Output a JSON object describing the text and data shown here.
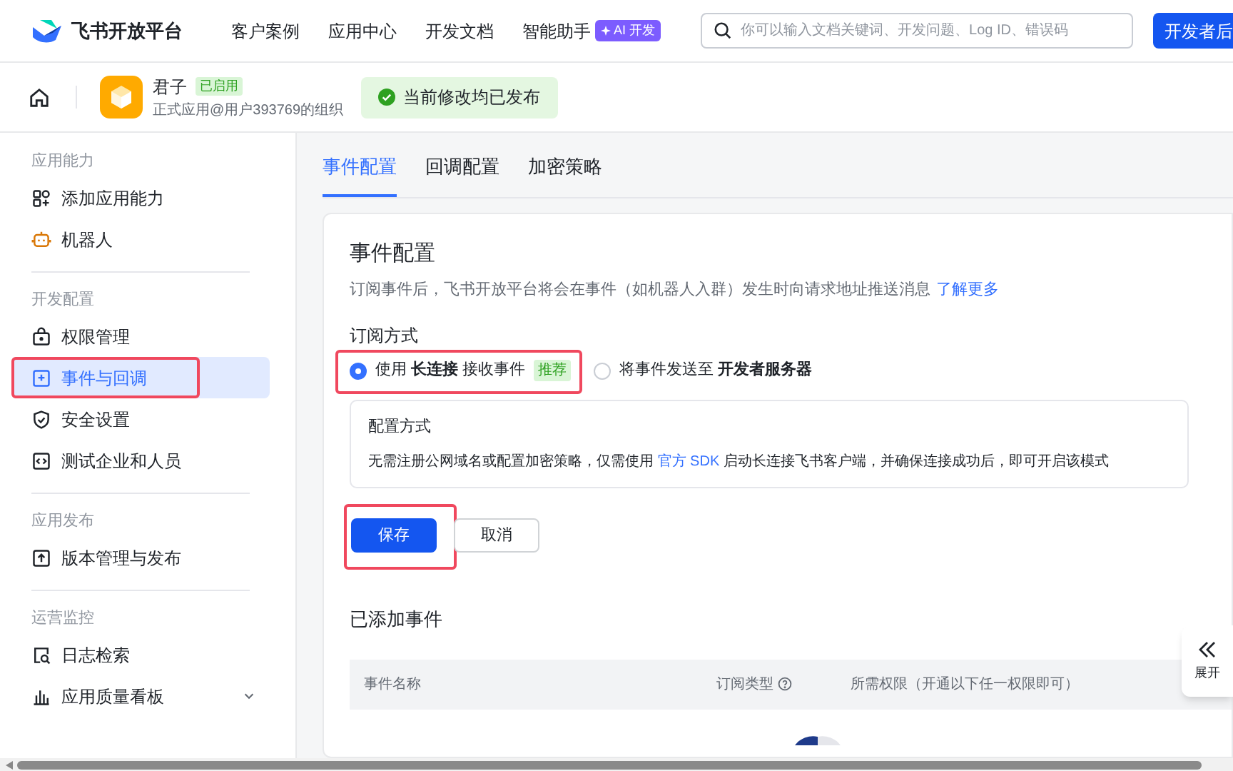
{
  "topnav": {
    "brand": "飞书开放平台",
    "links": [
      "客户案例",
      "应用中心",
      "开发文档",
      "智能助手"
    ],
    "ai_badge": "AI 开发",
    "search": {
      "placeholder": "你可以输入文档关键词、开发问题、Log ID、错误码"
    },
    "console_button": "开发者后"
  },
  "app_header": {
    "name": "君子",
    "status": "已启用",
    "subtitle": "正式应用@用户393769的组织",
    "notice": "当前修改均已发布"
  },
  "sidebar": {
    "groups": [
      {
        "title": "应用能力",
        "items": [
          {
            "label": "添加应用能力",
            "selected": false,
            "highlighted": false
          },
          {
            "label": "机器人",
            "selected": false,
            "highlighted": false
          }
        ]
      },
      {
        "title": "开发配置",
        "items": [
          {
            "label": "权限管理",
            "selected": false,
            "highlighted": false
          },
          {
            "label": "事件与回调",
            "selected": true,
            "highlighted": true
          },
          {
            "label": "安全设置",
            "selected": false,
            "highlighted": false
          },
          {
            "label": "测试企业和人员",
            "selected": false,
            "highlighted": false
          }
        ]
      },
      {
        "title": "应用发布",
        "items": [
          {
            "label": "版本管理与发布",
            "selected": false,
            "highlighted": false
          }
        ]
      },
      {
        "title": "运营监控",
        "items": [
          {
            "label": "日志检索",
            "selected": false,
            "highlighted": false
          },
          {
            "label": "应用质量看板",
            "selected": false,
            "highlighted": false,
            "expandable": true
          }
        ]
      }
    ]
  },
  "tabs": [
    {
      "label": "事件配置",
      "selected": true
    },
    {
      "label": "回调配置",
      "selected": false
    },
    {
      "label": "加密策略",
      "selected": false
    }
  ],
  "card": {
    "title": "事件配置",
    "description": "订阅事件后，飞书开放平台将会在事件（如机器人入群）发生时向请求地址推送消息",
    "learn_more": "了解更多",
    "mode_label": "订阅方式",
    "options": [
      {
        "label": "使用 **长连接** 接收事件",
        "tag": "推荐",
        "selected": true,
        "highlighted": true
      },
      {
        "label": "将事件发送至 **开发者服务器**",
        "selected": false,
        "highlighted": false
      }
    ],
    "config": {
      "title": "配置方式",
      "text_before": "无需注册公网域名或配置加密策略，仅需使用",
      "link": "官方 SDK",
      "text_after": "启动长连接飞书客户端，并确保连接成功后，即可开启该模式"
    },
    "buttons": [
      {
        "label": "保存",
        "kind": "primary",
        "highlighted": true
      },
      {
        "label": "取消",
        "kind": "secondary",
        "highlighted": false
      }
    ],
    "events_title": "已添加事件",
    "columns": [
      "事件名称",
      "订阅类型",
      "所需权限（开通以下任一权限即可）"
    ]
  },
  "expand_button": "展开"
}
